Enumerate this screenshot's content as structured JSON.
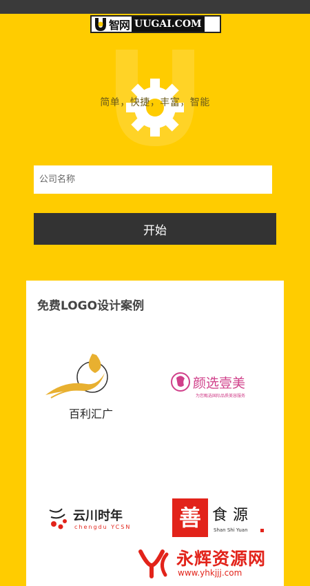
{
  "header": {
    "logo_cn": "智网",
    "logo_en": "UUGAI.COM"
  },
  "hero": {
    "tagline": "简单，快捷，丰富，智能"
  },
  "form": {
    "company_placeholder": "公司名称",
    "company_value": "",
    "start_label": "开始"
  },
  "cases": {
    "title": "免费LOGO设计案例",
    "items": [
      {
        "cn": "百利汇广"
      },
      {
        "cn": "颜选壹美",
        "sub": "为您甄选国际品质美容服务"
      },
      {
        "cn": "云川时年",
        "en": "chengdu YCSN"
      },
      {
        "cn": "食源",
        "en": "Shan Shi Yuan",
        "seal": "善"
      }
    ]
  },
  "watermark": {
    "cn": "永辉资源网",
    "url": "www.yhkjjj.com"
  },
  "colors": {
    "brand_yellow": "#FFCC00",
    "button_dark": "#333333",
    "accent_pink": "#d0408a",
    "accent_red": "#e2231a"
  }
}
